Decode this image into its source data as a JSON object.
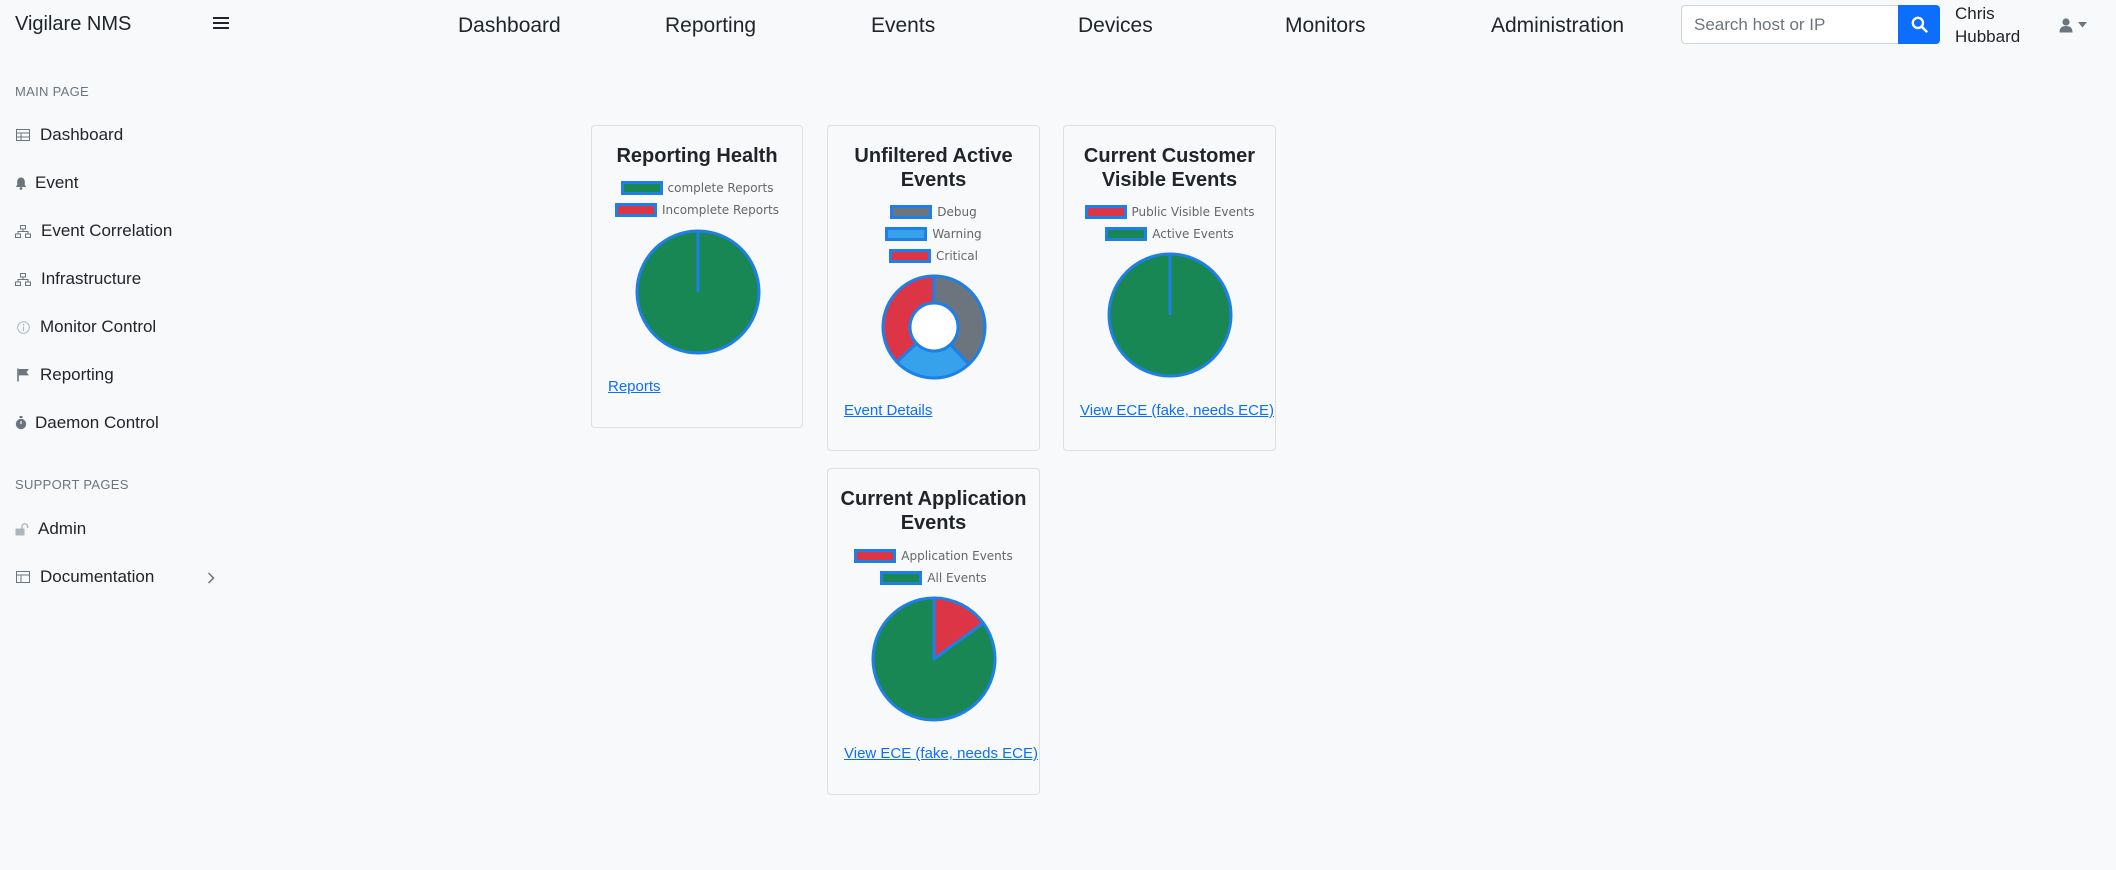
{
  "app": {
    "brand": "Vigilare NMS"
  },
  "nav": {
    "links": [
      "Dashboard",
      "Reporting",
      "Events",
      "Devices",
      "Monitors",
      "Administration"
    ],
    "search_placeholder": "Search host or IP",
    "user_first": "Chris",
    "user_last": "Hubbard"
  },
  "sidebar": {
    "main_heading": "MAIN PAGE",
    "main_items": [
      "Dashboard",
      "Event",
      "Event Correlation",
      "Infrastructure",
      "Monitor Control",
      "Reporting",
      "Daemon Control"
    ],
    "support_heading": "SUPPORT PAGES",
    "support_items": [
      "Admin",
      "Documentation"
    ]
  },
  "colors": {
    "green": "#198754",
    "red": "#dc3545",
    "gray": "#6c757d",
    "lightblue": "#36a2eb",
    "border": "#1e7fe8",
    "primary": "#0d6efd"
  },
  "cards": [
    {
      "title": "Reporting Health",
      "link": "Reports",
      "legend": [
        {
          "label": "complete Reports",
          "color": "#198754"
        },
        {
          "label": "Incomplete Reports",
          "color": "#dc3545"
        }
      ]
    },
    {
      "title": "Unfiltered Active Events",
      "link": "Event Details",
      "legend": [
        {
          "label": "Debug",
          "color": "#6c757d"
        },
        {
          "label": "Warning",
          "color": "#36a2eb"
        },
        {
          "label": "Critical",
          "color": "#dc3545"
        }
      ]
    },
    {
      "title": "Current Customer Visible Events",
      "link": "View ECE (fake, needs ECE)",
      "legend": [
        {
          "label": "Public Visible Events",
          "color": "#dc3545"
        },
        {
          "label": "Active Events",
          "color": "#198754"
        }
      ]
    },
    {
      "title": "Current Application Events",
      "link": "View ECE (fake, needs ECE)",
      "legend": [
        {
          "label": "Application Events",
          "color": "#dc3545"
        },
        {
          "label": "All Events",
          "color": "#198754"
        }
      ]
    }
  ],
  "chart_data": [
    {
      "type": "pie",
      "title": "Reporting Health",
      "categories": [
        "complete Reports",
        "Incomplete Reports"
      ],
      "values": [
        1,
        0
      ]
    },
    {
      "type": "pie",
      "title": "Unfiltered Active Events",
      "donut": true,
      "categories": [
        "Debug",
        "Warning",
        "Critical"
      ],
      "values": [
        38,
        25,
        37
      ]
    },
    {
      "type": "pie",
      "title": "Current Customer Visible Events",
      "categories": [
        "Public Visible Events",
        "Active Events"
      ],
      "values": [
        0,
        1
      ]
    },
    {
      "type": "pie",
      "title": "Current Application Events",
      "categories": [
        "Application Events",
        "All Events"
      ],
      "values": [
        15,
        85
      ]
    }
  ]
}
